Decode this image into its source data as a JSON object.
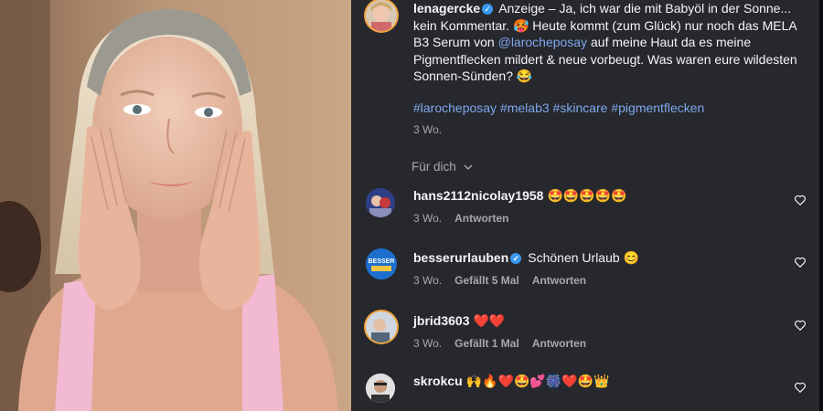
{
  "post": {
    "username": "lenagercke",
    "caption_part1": "Anzeige – Ja, ich war die mit Babyöl in der Sonne... kein Kommentar. 🥵 Heute kommt (zum Glück) nur noch das MELA B3 Serum von ",
    "caption_mention": "@larocheposay",
    "caption_part2": " auf meine Haut da es meine Pigmentflecken mildert & neue vorbeugt. Was waren eure wildesten Sonnen-Sünden? 😂",
    "hashtags": "#larocheposay #melab3 #skincare #pigmentflecken",
    "time": "3 Wo."
  },
  "sort_label": "Für dich",
  "comments": [
    {
      "user": "hans2112nicolay1958",
      "text": "🤩🤩🤩🤩🤩",
      "time": "3 Wo.",
      "likes": "",
      "reply": "Antworten"
    },
    {
      "user": "besserurlauben",
      "text": "Schönen Urlaub 😊",
      "time": "3 Wo.",
      "likes": "Gefällt 5 Mal",
      "reply": "Antworten"
    },
    {
      "user": "jbrid3603",
      "text": "❤️❤️",
      "time": "3 Wo.",
      "likes": "Gefällt 1 Mal",
      "reply": "Antworten"
    },
    {
      "user": "skrokcu",
      "text": "🙌🔥❤️🤩💕🎆❤️🤩👑",
      "time": "",
      "likes": "",
      "reply": ""
    }
  ],
  "colors": {
    "panel_bg": "#26282d",
    "link": "#7fa6ec",
    "verified": "#3897f0",
    "story_ring": "#f0a23a"
  },
  "icons": {
    "verified": "verified-badge-icon",
    "like": "heart-outline-icon",
    "sort": "chevron-down-icon"
  }
}
